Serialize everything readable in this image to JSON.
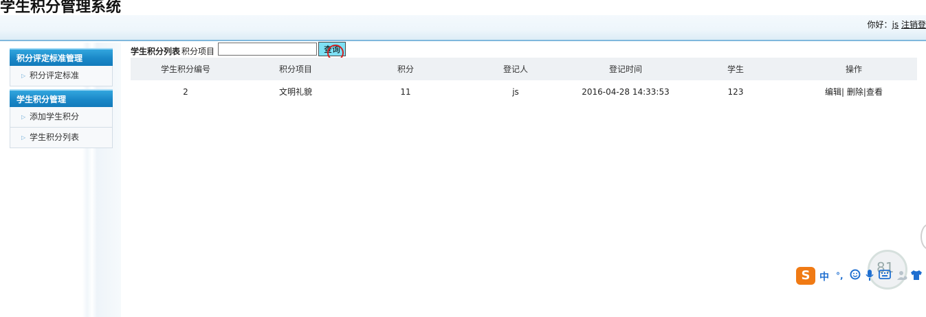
{
  "app": {
    "title": "学生积分管理系统"
  },
  "header": {
    "greeting_prefix": "你好：",
    "username": "js",
    "logout_label": "注销登"
  },
  "sidebar": {
    "sections": [
      {
        "title": "积分评定标准管理",
        "items": [
          {
            "label": "积分评定标准"
          }
        ]
      },
      {
        "title": "学生积分管理",
        "items": [
          {
            "label": "添加学生积分"
          },
          {
            "label": "学生积分列表"
          }
        ]
      }
    ]
  },
  "toolbar": {
    "title": "学生积分列表",
    "filter_label": "积分项目",
    "filter_value": "",
    "query_label": "查询"
  },
  "table": {
    "columns": [
      "学生积分编号",
      "积分项目",
      "积分",
      "登记人",
      "登记时间",
      "学生",
      "操作"
    ],
    "rows": [
      {
        "id": "2",
        "item": "文明礼貌",
        "score": "11",
        "registrar": "js",
        "time": "2016-04-28 14:33:53",
        "student": "123",
        "actions": {
          "edit": "编辑|",
          "delete": "删除|",
          "view": "查看"
        }
      }
    ]
  },
  "ime": {
    "logo": "S",
    "mode": "中",
    "punct": "°,",
    "circle_text": "81"
  },
  "colors": {
    "sidebar_header": "#1a88c8",
    "header_border": "#7fb8dd",
    "query_button": "#7ee0f4",
    "table_header_bg": "#eef1f4"
  }
}
